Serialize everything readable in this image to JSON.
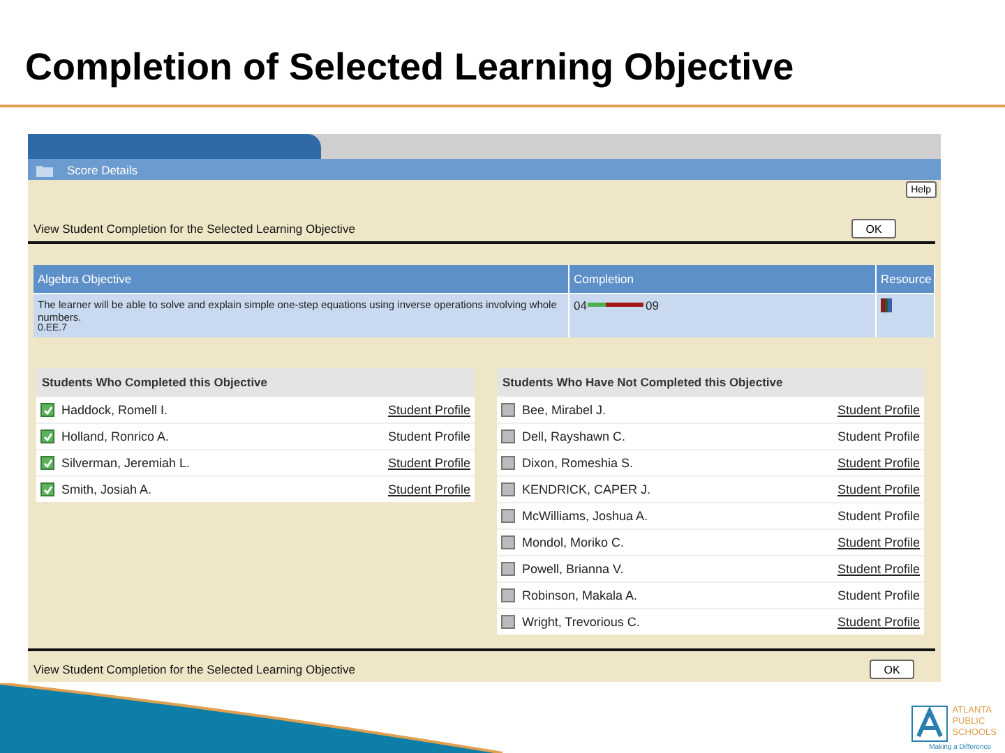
{
  "slide": {
    "title": "Completion of Selected Learning Objective"
  },
  "panel": {
    "title": "Score Details",
    "help_button": "Help",
    "heading": "View Student Completion for the Selected Learning Objective",
    "ok_button": "OK"
  },
  "objective_table": {
    "columns": [
      "Algebra Objective",
      "Completion",
      "Resource"
    ],
    "rows": [
      {
        "objective": "The learner will be able to solve and explain simple one-step equations using inverse operations involving whole numbers.",
        "code": "0.EE.7",
        "completed": "04",
        "not_completed": "09",
        "level": 0.31
      }
    ]
  },
  "completed_list": {
    "title": "Students Who Completed this Objective",
    "students": [
      {
        "name": "Haddock, Romell I.",
        "checked": true,
        "link": "Student Profile",
        "underlined": true
      },
      {
        "name": "Holland, Ronrico A.",
        "checked": true,
        "link": "Student Profile",
        "underlined": false
      },
      {
        "name": "Silverman, Jeremiah L.",
        "checked": true,
        "link": "Student Profile",
        "underlined": true
      },
      {
        "name": "Smith, Josiah A.",
        "checked": true,
        "link": "Student Profile",
        "underlined": true
      }
    ]
  },
  "not_completed_list": {
    "title": "Students Who Have Not Completed this Objective",
    "students": [
      {
        "name": "Bee, Mirabel J.",
        "checked": false,
        "link": "Student Profile",
        "underlined": true
      },
      {
        "name": "Dell, Rayshawn C.",
        "checked": false,
        "link": "Student Profile",
        "underlined": false
      },
      {
        "name": "Dixon, Romeshia S.",
        "checked": false,
        "link": "Student Profile",
        "underlined": true
      },
      {
        "name": "KENDRICK, CAPER J.",
        "checked": false,
        "link": "Student Profile",
        "underlined": true
      },
      {
        "name": "McWilliams, Joshua A.",
        "checked": false,
        "link": "Student Profile",
        "underlined": false
      },
      {
        "name": "Mondol, Moriko C.",
        "checked": false,
        "link": "Student Profile",
        "underlined": true
      },
      {
        "name": "Powell, Brianna V.",
        "checked": false,
        "link": "Student Profile",
        "underlined": true
      },
      {
        "name": "Robinson, Makala A.",
        "checked": false,
        "link": "Student Profile",
        "underlined": false
      },
      {
        "name": "Wright, Trevorious C.",
        "checked": false,
        "link": "Student Profile",
        "underlined": true
      }
    ]
  },
  "footer": {
    "heading": "View Student Completion for the Selected Learning Objective",
    "ok_button": "OK"
  },
  "logo": {
    "name_lines": [
      "ATLANTA",
      "PUBLIC",
      "SCHOOLS"
    ],
    "tagline": "Making a Difference"
  }
}
